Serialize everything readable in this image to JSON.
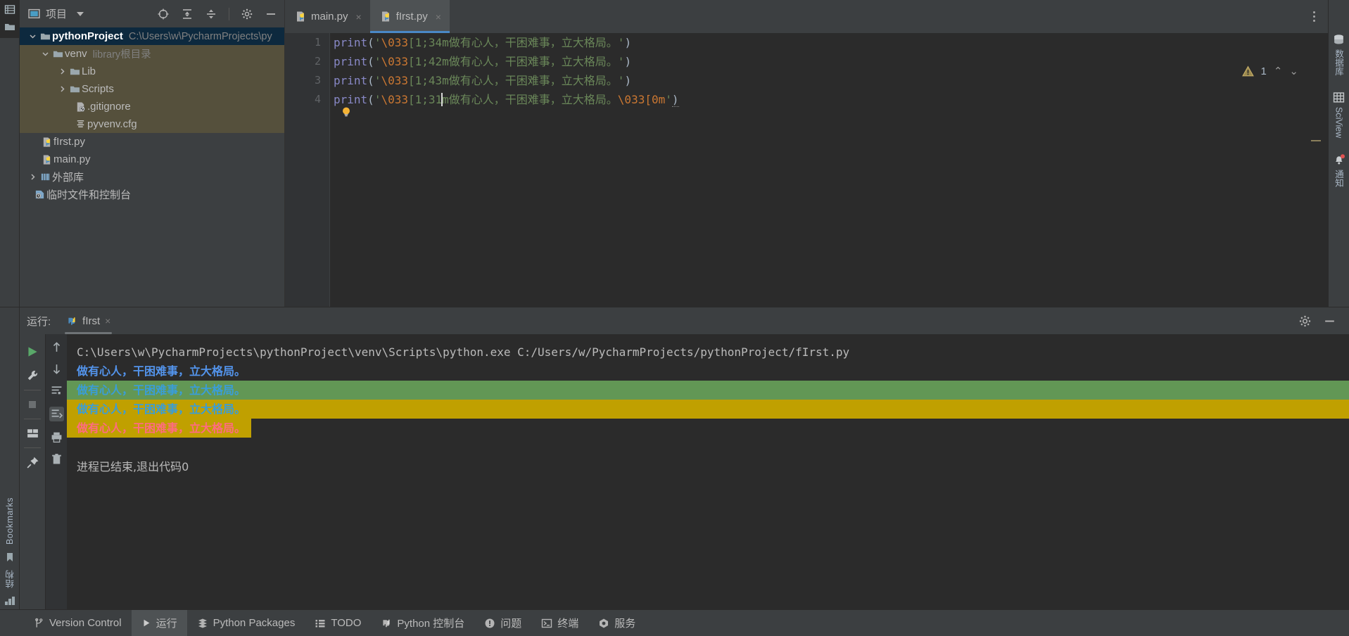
{
  "left_rail": {
    "items": [
      {
        "name": "project",
        "label": "项目",
        "icon": "project-icon"
      },
      {
        "name": "bookmarks",
        "label": "Bookmarks",
        "icon": "bookmark-icon"
      },
      {
        "name": "structure",
        "label": "结构",
        "icon": "structure-icon"
      }
    ]
  },
  "project_panel": {
    "title": "项目",
    "toolbar": [
      "locate-icon",
      "expand-all-icon",
      "collapse-all-icon",
      "gear-icon",
      "minimize-icon"
    ],
    "tree": [
      {
        "label": "pythonProject",
        "sub": "C:\\Users\\w\\PycharmProjects\\py",
        "icon": "folder-icon",
        "indent": 0,
        "arrow": "down",
        "selected": true,
        "bold": true
      },
      {
        "label": "venv",
        "sub": "library根目录",
        "icon": "folder-icon",
        "indent": 1,
        "arrow": "down",
        "group": true
      },
      {
        "label": "Lib",
        "sub": "",
        "icon": "folder-icon",
        "indent": 2,
        "arrow": "right",
        "group": true
      },
      {
        "label": "Scripts",
        "sub": "",
        "icon": "folder-icon",
        "indent": 2,
        "arrow": "right",
        "group": true
      },
      {
        "label": ".gitignore",
        "sub": "",
        "icon": "gitignore-file-icon",
        "indent": 3,
        "arrow": "",
        "group": true
      },
      {
        "label": "pyvenv.cfg",
        "sub": "",
        "icon": "cfg-file-icon",
        "indent": 3,
        "arrow": "",
        "group": true
      },
      {
        "label": "fIrst.py",
        "sub": "",
        "icon": "python-file-icon",
        "indent": 1,
        "arrow": ""
      },
      {
        "label": "main.py",
        "sub": "",
        "icon": "python-file-icon",
        "indent": 1,
        "arrow": ""
      },
      {
        "label": "外部库",
        "sub": "",
        "icon": "library-icon",
        "indent": 0,
        "arrow": "right"
      },
      {
        "label": "临时文件和控制台",
        "sub": "",
        "icon": "scratches-icon",
        "indent": 0,
        "arrow": ""
      }
    ]
  },
  "editor": {
    "tabs": [
      {
        "label": "main.py",
        "icon": "python-file-icon",
        "active": false,
        "close": "×"
      },
      {
        "label": "fIrst.py",
        "icon": "python-file-icon",
        "active": true,
        "close": "×"
      }
    ],
    "line_numbers": [
      "1",
      "2",
      "3",
      "4"
    ],
    "lines": [
      {
        "num": "1",
        "func": "print",
        "open": "(",
        "quote": "'",
        "esc": "\\033",
        "code": "[1;34m",
        "text": "做有心人，干困难事，立大格局。",
        "endesc": "",
        "endquote": "'",
        "close": ")"
      },
      {
        "num": "2",
        "func": "print",
        "open": "(",
        "quote": "'",
        "esc": "\\033",
        "code": "[1;42m",
        "text": "做有心人，干困难事，立大格局。",
        "endesc": "",
        "endquote": "'",
        "close": ")"
      },
      {
        "num": "3",
        "func": "print",
        "open": "(",
        "quote": "'",
        "esc": "\\033",
        "code": "[1;43m",
        "text": "做有心人，干困难事，立大格局。",
        "endesc": "",
        "endquote": "'",
        "close": ")"
      },
      {
        "num": "4",
        "func": "print",
        "open": "(",
        "quote": "'",
        "esc": "\\033",
        "code": "[1;31",
        "text": "m做有心人，干困难事，立大格局。",
        "endesc": "\\033[0m",
        "endquote": "'",
        "close": ")"
      }
    ],
    "inspection": {
      "warning_count": "1",
      "icon": "warning-triangle-icon",
      "up": "⌃",
      "down": "⌄"
    },
    "kebab": "more-options-icon"
  },
  "right_rail": {
    "items": [
      {
        "name": "database",
        "label": "数据库",
        "icon": "database-icon"
      },
      {
        "name": "sciview",
        "label": "SciView",
        "icon": "sciview-icon"
      },
      {
        "name": "notifications",
        "label": "通知",
        "icon": "bell-icon"
      }
    ]
  },
  "run_panel": {
    "title": "运行:",
    "tab": {
      "label": "fIrst",
      "icon": "python-file-icon",
      "close": "×"
    },
    "header_buttons": [
      "gear-icon",
      "minimize-icon"
    ],
    "side_buttons": [
      "run-icon",
      "wrench-icon",
      "stop-icon",
      "layout-icon",
      "pin-icon"
    ],
    "gutter_buttons": [
      "scroll-up-icon",
      "scroll-down-icon",
      "soft-wrap-icon",
      "scroll-to-end-icon",
      "print-icon",
      "trash-icon"
    ],
    "console": {
      "command": "C:\\Users\\w\\PycharmProjects\\pythonProject\\venv\\Scripts\\python.exe C:/Users/w/PycharmProjects/pythonProject/fIrst.py",
      "output_lines": [
        {
          "text": "做有心人，干困难事，立大格局。",
          "fg": "#5394ec",
          "bg": "none",
          "width": "auto"
        },
        {
          "text": "做有心人，干困难事，立大格局。",
          "fg": "#3a9dd8",
          "bg": "#629755",
          "width": "full"
        },
        {
          "text": "做有心人，干困难事，立大格局。",
          "fg": "#3a9dd8",
          "bg": "#c0a000",
          "width": "full"
        },
        {
          "text": "做有心人，干困难事，立大格局。",
          "fg": "#ff6b81",
          "bg": "#c0a000",
          "width": "part"
        }
      ],
      "exit_message": "进程已结束,退出代码0"
    }
  },
  "status_bar": {
    "items": [
      {
        "label": "Version Control",
        "icon": "branch-icon",
        "active": false
      },
      {
        "label": "运行",
        "icon": "run-icon",
        "active": true
      },
      {
        "label": "Python Packages",
        "icon": "packages-icon",
        "active": false
      },
      {
        "label": "TODO",
        "icon": "todo-icon",
        "active": false
      },
      {
        "label": "Python 控制台",
        "icon": "python-console-icon",
        "active": false
      },
      {
        "label": "问题",
        "icon": "problems-icon",
        "active": false
      },
      {
        "label": "终端",
        "icon": "terminal-icon",
        "active": false
      },
      {
        "label": "服务",
        "icon": "services-icon",
        "active": false
      }
    ]
  },
  "colors": {
    "bg": "#3c3f41",
    "editor_bg": "#2b2b2b",
    "accent": "#4a88c7",
    "selected": "#0d293e",
    "group": "#55503c",
    "green": "#629755",
    "olive": "#c0a000"
  }
}
